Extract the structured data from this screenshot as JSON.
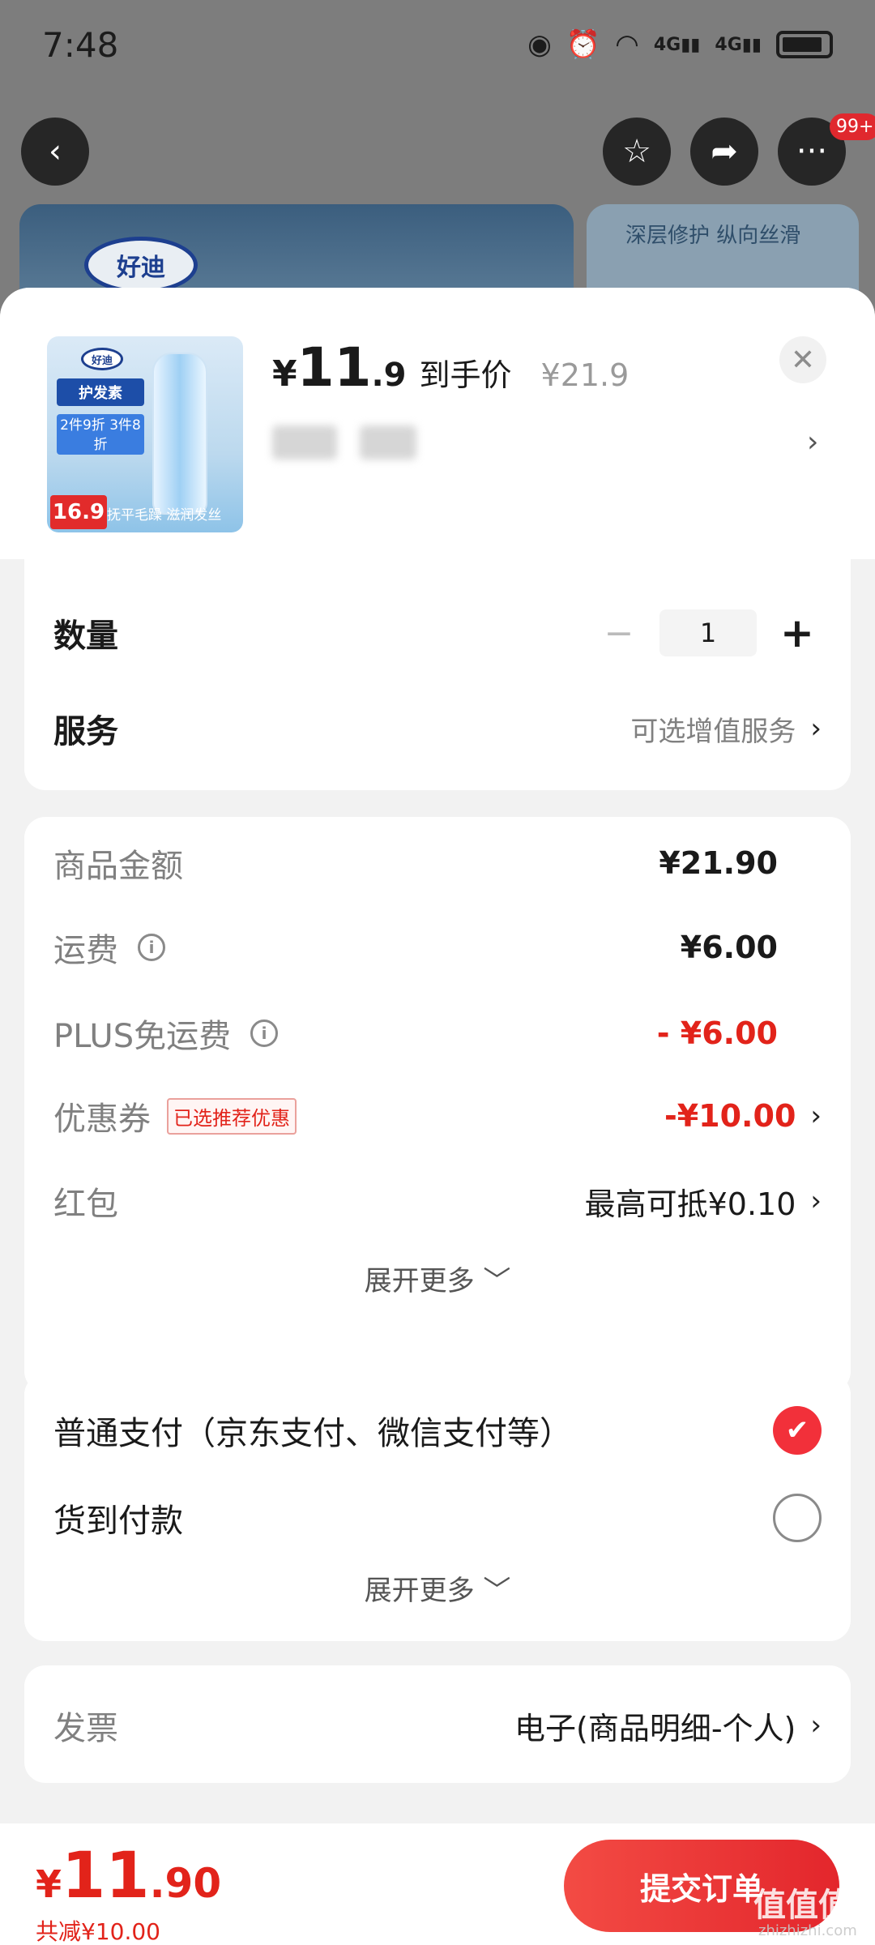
{
  "status_bar": {
    "time": "7:48",
    "net1": "4G",
    "net2": "4G"
  },
  "top_nav": {
    "badge": "99+"
  },
  "background": {
    "brand_logo": "好迪",
    "banner2_text": "深层修护 纵向丝滑"
  },
  "product": {
    "thumb_brand": "好迪",
    "thumb_tag1": "护发素",
    "thumb_tag2": "2件9折 3件8折",
    "thumb_price": "16.9",
    "thumb_slogan": "抚平毛躁 滋润发丝",
    "price_currency": "¥",
    "price_int": "11",
    "price_dec": ".9",
    "price_label": "到手价",
    "original_price": "¥21.9"
  },
  "options": {
    "qty_label": "数量",
    "qty_value": "1",
    "service_label": "服务",
    "service_value": "可选增值服务"
  },
  "amounts": {
    "goods_label": "商品金额",
    "goods_value": "¥21.90",
    "shipping_label": "运费",
    "shipping_value": "¥6.00",
    "plus_label": "PLUS免运费",
    "plus_value": "- ¥6.00",
    "coupon_label": "优惠券",
    "coupon_tag": "已选推荐优惠",
    "coupon_value": "-¥10.00",
    "redpacket_label": "红包",
    "redpacket_value": "最高可抵¥0.10",
    "expand": "展开更多"
  },
  "payment": {
    "normal_label": "普通支付（京东支付、微信支付等）",
    "cod_label": "货到付款",
    "expand": "展开更多"
  },
  "invoice": {
    "label": "发票",
    "value": "电子(商品明细-个人)"
  },
  "footer": {
    "currency": "¥",
    "total_int": "11",
    "total_dec": ".90",
    "saved": "共减¥10.00",
    "submit": "提交订单",
    "watermark": "值值值",
    "watermark_url": "zhizhizhi.com"
  },
  "colors": {
    "accent_red": "#e2231a",
    "button_red": "#f03a3a"
  }
}
